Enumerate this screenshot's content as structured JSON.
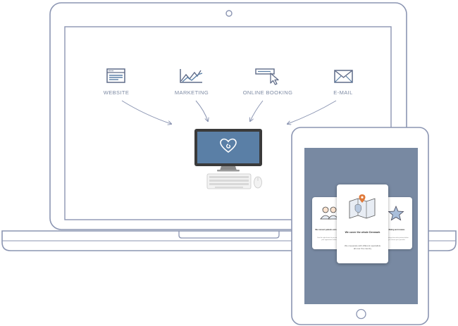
{
  "features": [
    {
      "id": "website",
      "label": "WEBSITE",
      "icon": "browser-window-icon"
    },
    {
      "id": "marketing",
      "label": "MARKETING",
      "icon": "chart-line-icon"
    },
    {
      "id": "online_booking",
      "label": "ONLINE BOOKING",
      "icon": "cursor-click-icon"
    },
    {
      "id": "email",
      "label": "E-MAIL",
      "icon": "envelope-icon"
    }
  ],
  "desktop": {
    "logo": "heart-logo-icon"
  },
  "tablet": {
    "center_card": {
      "title": "We cover the whole Denmark",
      "body": "We cooperate with different specialists all over the country"
    },
    "left_card": {
      "title": "We connect patients and doctors",
      "body": "Find the right doctor for you and book your appointment online"
    },
    "right_card": {
      "title": "Rating and reviews",
      "body": "See ratings from other patients before you choose your specialist"
    }
  },
  "colors": {
    "outline": "#8b95b2",
    "accent_blue": "#5a7fa6",
    "tablet_screen": "#7889a2",
    "pin_orange": "#e07a3a"
  }
}
